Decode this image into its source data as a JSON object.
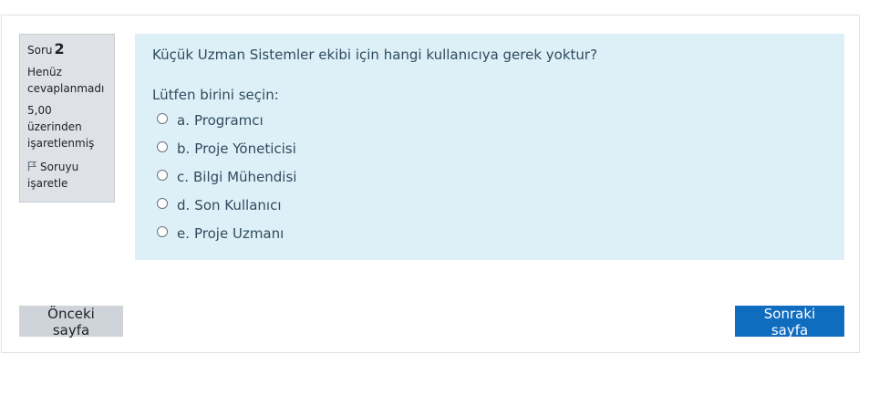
{
  "question_info": {
    "label": "Soru",
    "number": "2",
    "state_line1": "Henüz",
    "state_line2": "cevaplanmadı",
    "grade_line1": "5,00",
    "grade_line2": "üzerinden",
    "grade_line3": "işaretlenmiş",
    "flag_line1": "Soruyu",
    "flag_line2": "işaretle",
    "flag_icon": "flag-icon"
  },
  "question": {
    "text": "Küçük Uzman Sistemler ekibi için hangi kullanıcıya gerek yoktur?",
    "prompt": "Lütfen birini seçin:",
    "answers": [
      {
        "letter": "a.",
        "text": "Programcı"
      },
      {
        "letter": "b.",
        "text": "Proje Yöneticisi"
      },
      {
        "letter": "c.",
        "text": "Bilgi Mühendisi"
      },
      {
        "letter": "d.",
        "text": "Son Kullanıcı"
      },
      {
        "letter": "e.",
        "text": "Proje Uzmanı"
      }
    ]
  },
  "navigation": {
    "prev_label": "Önceki sayfa",
    "next_label": "Sonraki sayfa"
  },
  "colors": {
    "content_bg": "#def0f7",
    "info_bg": "#dee2e6",
    "primary": "#0f6cbf",
    "secondary": "#ced4da"
  }
}
